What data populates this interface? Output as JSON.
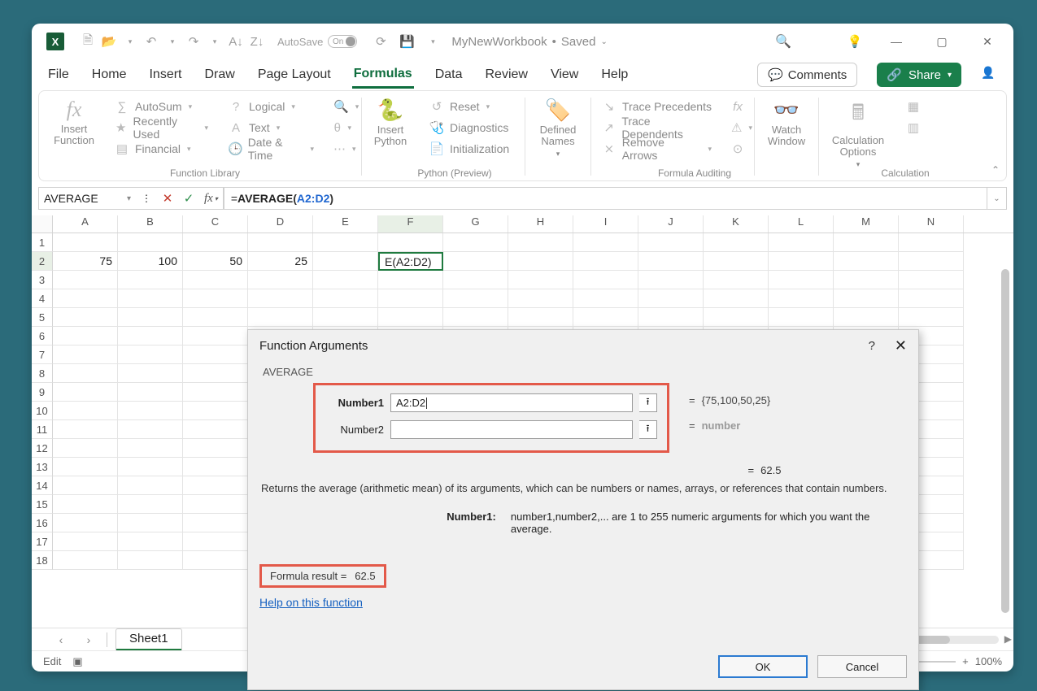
{
  "titlebar": {
    "autosave_label": "AutoSave",
    "autosave_state": "On",
    "doc_name": "MyNewWorkbook",
    "doc_status": "Saved"
  },
  "tabs": {
    "file": "File",
    "home": "Home",
    "insert": "Insert",
    "draw": "Draw",
    "page_layout": "Page Layout",
    "formulas": "Formulas",
    "data": "Data",
    "review": "Review",
    "view": "View",
    "help": "Help",
    "comments": "Comments",
    "share": "Share"
  },
  "ribbon": {
    "insert_function": "Insert Function",
    "autosum": "AutoSum",
    "recently_used": "Recently Used",
    "financial": "Financial",
    "logical": "Logical",
    "text": "Text",
    "date_time": "Date & Time",
    "insert_python": "Insert Python",
    "reset": "Reset",
    "diagnostics": "Diagnostics",
    "initialization": "Initialization",
    "defined_names": "Defined Names",
    "trace_precedents": "Trace Precedents",
    "trace_dependents": "Trace Dependents",
    "remove_arrows": "Remove Arrows",
    "watch_window": "Watch Window",
    "calculation_options": "Calculation Options",
    "group_function_library": "Function Library",
    "group_python": "Python (Preview)",
    "group_auditing": "Formula Auditing",
    "group_calc": "Calculation"
  },
  "formula_bar": {
    "name_box": "AVERAGE",
    "formula_prefix": "=",
    "formula_fn": "AVERAGE",
    "formula_open": "(",
    "formula_range": "A2:D2",
    "formula_close": ")"
  },
  "grid": {
    "columns": [
      "A",
      "B",
      "C",
      "D",
      "E",
      "F",
      "G",
      "H",
      "I",
      "J",
      "K",
      "L",
      "M",
      "N"
    ],
    "row_headers": [
      1,
      2,
      3,
      4,
      5,
      6,
      7,
      8,
      9,
      10,
      11,
      12,
      13,
      14,
      15,
      16,
      17,
      18
    ],
    "active_col": "F",
    "active_row": 2,
    "data_row2": {
      "A": "75",
      "B": "100",
      "C": "50",
      "D": "25",
      "F": "E(A2:D2)"
    }
  },
  "sheet_tabs": {
    "sheet1": "Sheet1"
  },
  "status_bar": {
    "mode": "Edit",
    "zoom": "100%"
  },
  "dialog": {
    "title": "Function Arguments",
    "fn_name": "AVERAGE",
    "arg1_label": "Number1",
    "arg1_value": "A2:D2",
    "arg1_preview": "{75,100,50,25}",
    "arg2_label": "Number2",
    "arg2_value": "",
    "arg2_preview": "number",
    "mid_result": "62.5",
    "description": "Returns the average (arithmetic mean) of its arguments, which can be numbers or names, arrays, or references that contain numbers.",
    "arg_desc_label": "Number1:",
    "arg_desc_text": "number1,number2,... are 1 to 255 numeric arguments for which you want the average.",
    "result_label": "Formula result =",
    "result_value": "62.5",
    "help_link": "Help on this function",
    "ok": "OK",
    "cancel": "Cancel"
  }
}
